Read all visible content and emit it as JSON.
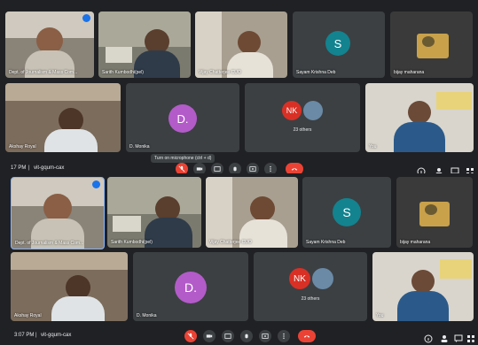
{
  "top": {
    "tiles": [
      {
        "name": "Dept. of Journalism & Mass Com...",
        "type": "video"
      },
      {
        "name": "Sarith Kumbodhi(pel)",
        "type": "video"
      },
      {
        "name": "Vijay Chatterjee CUO",
        "type": "video"
      },
      {
        "name": "Sayam Krishna Deb",
        "type": "avatar",
        "initial": "S",
        "color": "#12838f"
      },
      {
        "name": "bijay maharana",
        "type": "video"
      },
      {
        "name": "Akshay Royal",
        "type": "video"
      },
      {
        "name": "D. Monika",
        "type": "avatar",
        "initial": "D.",
        "color": "#b35bc9"
      },
      {
        "name": "23 others",
        "type": "group",
        "initials": "NK"
      },
      {
        "name": "You",
        "type": "video"
      }
    ],
    "tooltip": "Turn on microphone (ctrl + d)",
    "time": "17 PM",
    "separator": "|",
    "meeting_code": "vit-gqum-cax"
  },
  "bottom": {
    "tiles": [
      {
        "name": "Dept. of Journalism & Mass Com...",
        "type": "video"
      },
      {
        "name": "Sarith Kumbodhi(pel)",
        "type": "video"
      },
      {
        "name": "Vijay Chatterjee CUO",
        "type": "video"
      },
      {
        "name": "Sayam Krishna Deb",
        "type": "avatar",
        "initial": "S",
        "color": "#12838f"
      },
      {
        "name": "bijay maharana",
        "type": "video"
      },
      {
        "name": "Akshay Royal",
        "type": "video"
      },
      {
        "name": "D. Monika",
        "type": "avatar",
        "initial": "D.",
        "color": "#b35bc9"
      },
      {
        "name": "23 others",
        "type": "group",
        "initials": "NK"
      },
      {
        "name": "You",
        "type": "video"
      }
    ],
    "time": "3:07 PM",
    "separator": "|",
    "meeting_code": "vit-gqum-cax"
  },
  "colors": {
    "accent_red": "#ea4335",
    "bg": "#202124",
    "tile": "#3c4043",
    "nk": "#d93025",
    "blue": "#1a73e8"
  },
  "icons": [
    "mic-off-icon",
    "camera-icon",
    "captions-icon",
    "raise-hand-icon",
    "present-icon",
    "more-icon",
    "end-call-icon",
    "info-icon",
    "people-icon",
    "chat-icon",
    "activities-icon"
  ]
}
